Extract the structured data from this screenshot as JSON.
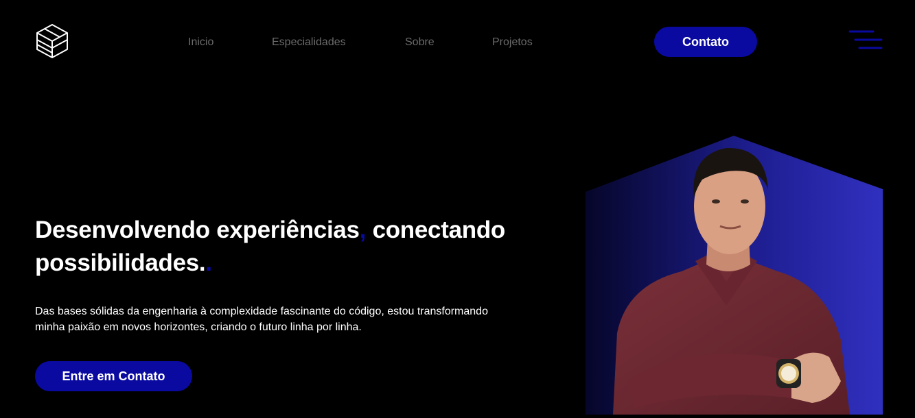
{
  "nav": {
    "items": [
      {
        "label": "Inicio"
      },
      {
        "label": "Especialidades"
      },
      {
        "label": "Sobre"
      },
      {
        "label": "Projetos"
      }
    ],
    "contact_button": "Contato"
  },
  "hero": {
    "title_part1": "Desenvolvendo experiências",
    "title_comma": ",",
    "title_part2": " conectando possibilidades.",
    "title_dot": ".",
    "description": "Das bases sólidas da engenharia à complexidade fascinante do código, estou transformando minha paixão em novos horizontes, criando o futuro linha por linha.",
    "cta_button": "Entre em Contato"
  },
  "icons": {
    "logo": "cube-logo-icon",
    "menu": "hamburger-menu-icon"
  },
  "colors": {
    "background": "#000000",
    "accent": "#0a0aa1",
    "nav_text": "#6b6b6b",
    "hexagon_gradient_start": "#06062a",
    "hexagon_gradient_end": "#3030c0",
    "shirt": "#6e2a34"
  }
}
